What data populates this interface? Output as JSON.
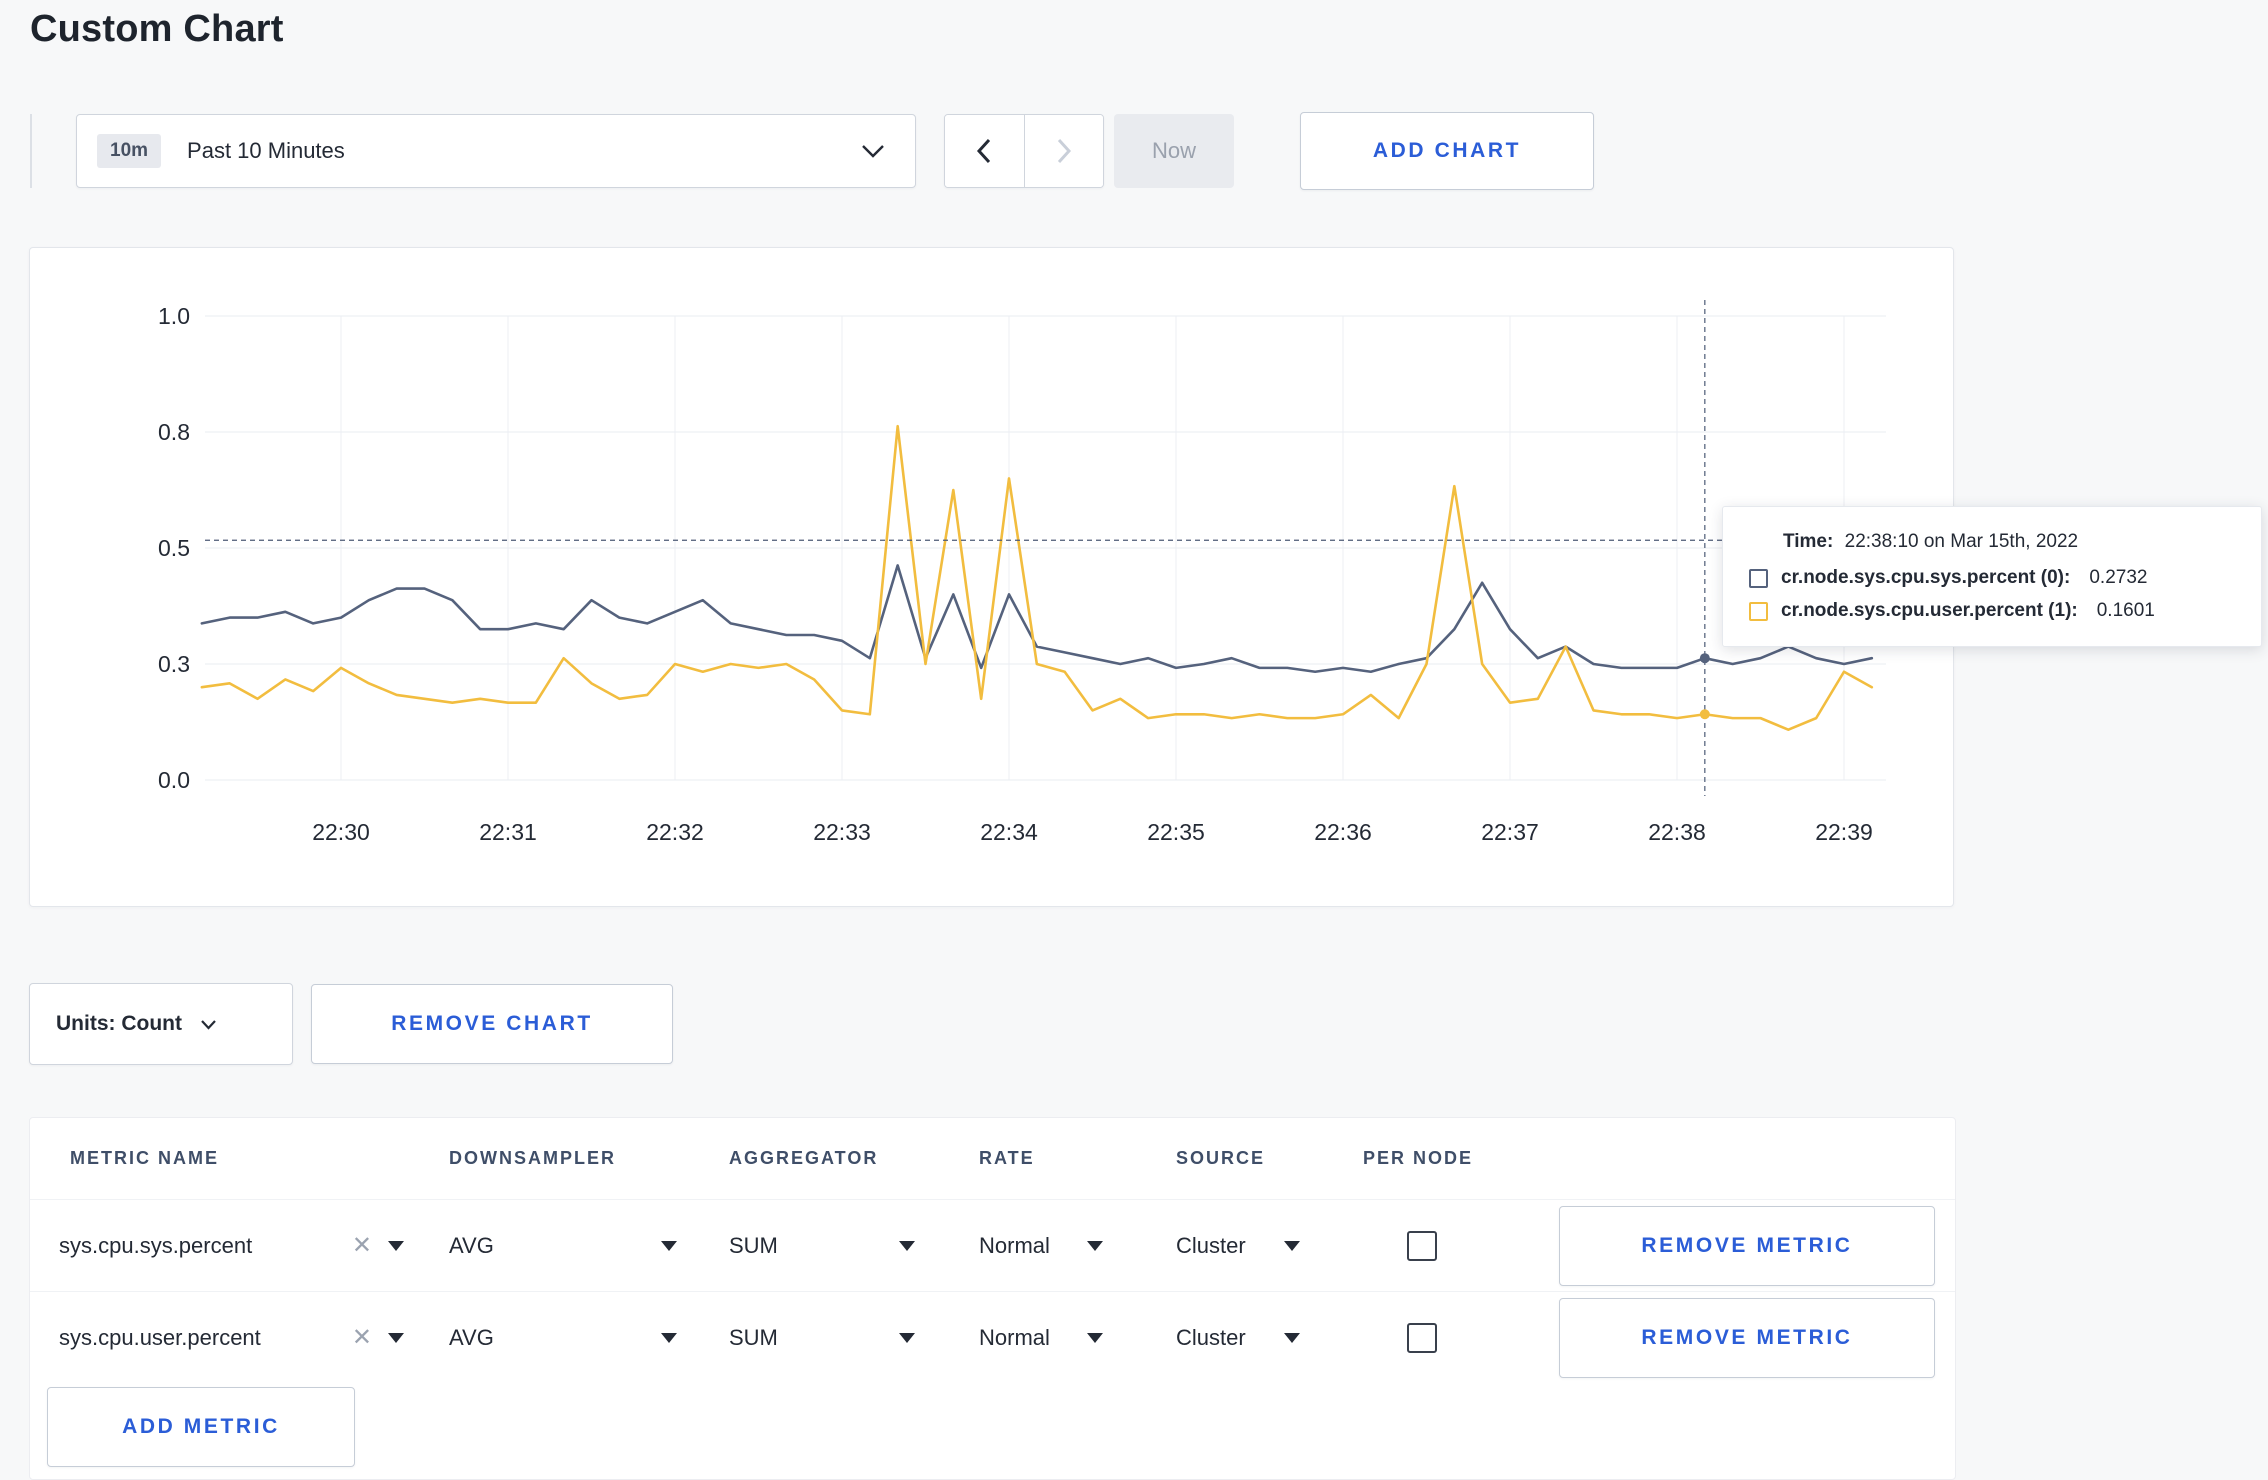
{
  "page": {
    "title": "Custom Chart"
  },
  "toolbar": {
    "time_window_badge": "10m",
    "time_window_label": "Past 10 Minutes",
    "now_button": "Now",
    "add_chart_button": "ADD CHART"
  },
  "chart_data": {
    "type": "line",
    "x_ticks": [
      "22:30",
      "22:31",
      "22:32",
      "22:33",
      "22:34",
      "22:35",
      "22:36",
      "22:37",
      "22:38",
      "22:39"
    ],
    "x_tick_start_index": 5,
    "x_points_per_tick": 6,
    "x_interval_seconds": 10,
    "y_ticks": [
      {
        "label": "0.0",
        "value": 0.0
      },
      {
        "label": "0.3",
        "value": 0.3
      },
      {
        "label": "0.5",
        "value": 0.5
      },
      {
        "label": "0.8",
        "value": 0.8
      },
      {
        "label": "1.0",
        "value": 1.0
      }
    ],
    "grid": true,
    "series": [
      {
        "name": "cr.node.sys.cpu.sys.percent",
        "color": "#55627d",
        "values": [
          0.37,
          0.38,
          0.38,
          0.39,
          0.37,
          0.38,
          0.41,
          0.43,
          0.43,
          0.41,
          0.36,
          0.36,
          0.37,
          0.36,
          0.41,
          0.38,
          0.37,
          0.39,
          0.41,
          0.37,
          0.36,
          0.35,
          0.35,
          0.34,
          0.31,
          0.47,
          0.31,
          0.42,
          0.29,
          0.42,
          0.33,
          0.32,
          0.31,
          0.3,
          0.31,
          0.29,
          0.3,
          0.31,
          0.29,
          0.29,
          0.28,
          0.29,
          0.28,
          0.3,
          0.31,
          0.36,
          0.44,
          0.36,
          0.31,
          0.33,
          0.3,
          0.29,
          0.29,
          0.29,
          0.31,
          0.3,
          0.31,
          0.33,
          0.31,
          0.3,
          0.31
        ]
      },
      {
        "name": "cr.node.sys.cpu.user.percent",
        "color": "#f2bd3f",
        "values": [
          0.24,
          0.25,
          0.21,
          0.26,
          0.23,
          0.29,
          0.25,
          0.22,
          0.21,
          0.2,
          0.21,
          0.2,
          0.2,
          0.31,
          0.25,
          0.21,
          0.22,
          0.3,
          0.28,
          0.3,
          0.29,
          0.3,
          0.26,
          0.18,
          0.17,
          0.81,
          0.3,
          0.65,
          0.21,
          0.68,
          0.3,
          0.28,
          0.18,
          0.21,
          0.16,
          0.17,
          0.17,
          0.16,
          0.17,
          0.16,
          0.16,
          0.17,
          0.22,
          0.16,
          0.3,
          0.66,
          0.3,
          0.2,
          0.21,
          0.33,
          0.18,
          0.17,
          0.17,
          0.16,
          0.17,
          0.16,
          0.16,
          0.13,
          0.16,
          0.28,
          0.24
        ]
      }
    ],
    "crosshair": {
      "index": 54,
      "hline_value": 0.52,
      "dots": [
        {
          "series": 0,
          "value": 0.31
        },
        {
          "series": 1,
          "value": 0.17
        }
      ]
    }
  },
  "tooltip": {
    "time_label": "Time:",
    "time_value": "22:38:10 on Mar 15th, 2022",
    "rows": [
      {
        "name": "cr.node.sys.cpu.sys.percent (0):",
        "value": "0.2732",
        "color": "#55627d"
      },
      {
        "name": "cr.node.sys.cpu.user.percent (1):",
        "value": "0.1601",
        "color": "#f2bd3f"
      }
    ]
  },
  "chart_controls": {
    "units_button": "Units: Count",
    "remove_chart_button": "REMOVE CHART"
  },
  "metrics_table": {
    "headers": [
      "METRIC NAME",
      "DOWNSAMPLER",
      "AGGREGATOR",
      "RATE",
      "SOURCE",
      "PER NODE"
    ],
    "rows": [
      {
        "metric": "sys.cpu.sys.percent",
        "downsampler": "AVG",
        "aggregator": "SUM",
        "rate": "Normal",
        "source": "Cluster",
        "per_node_checked": false,
        "remove_button": "REMOVE METRIC"
      },
      {
        "metric": "sys.cpu.user.percent",
        "downsampler": "AVG",
        "aggregator": "SUM",
        "rate": "Normal",
        "source": "Cluster",
        "per_node_checked": false,
        "remove_button": "REMOVE METRIC"
      }
    ],
    "add_metric_button": "ADD METRIC"
  }
}
